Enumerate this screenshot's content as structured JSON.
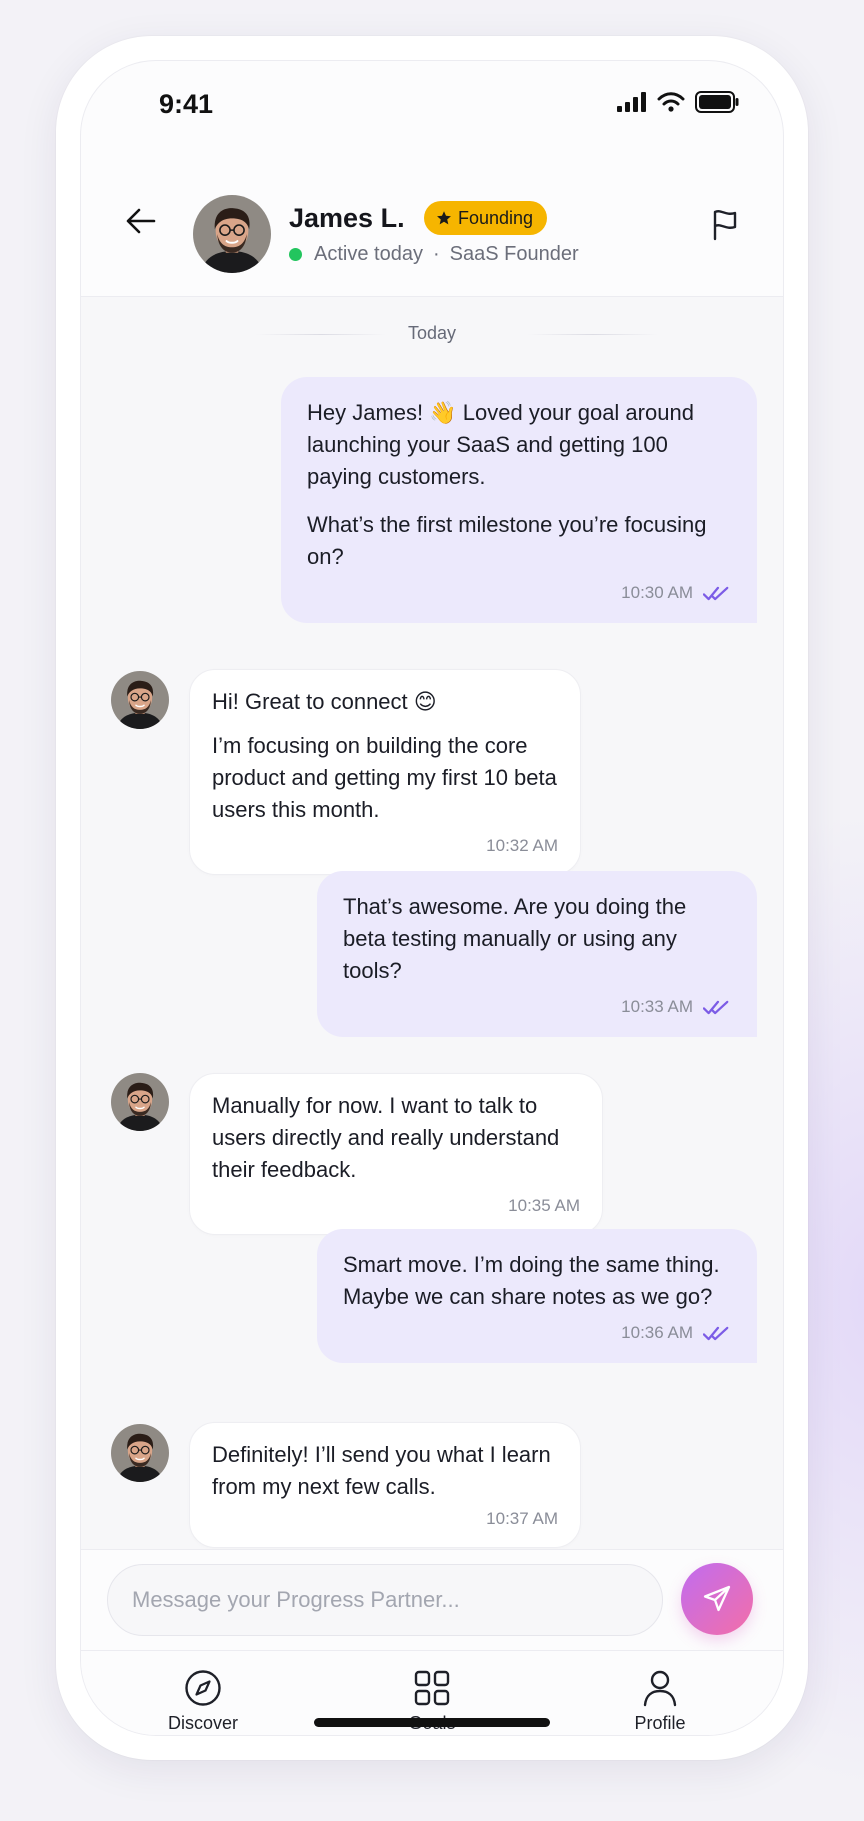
{
  "status_bar": {
    "time": "9:41"
  },
  "header": {
    "name": "James L.",
    "badge": "Founding",
    "presence": "Active today",
    "separator": "·",
    "role": "SaaS Founder"
  },
  "chat": {
    "day_label": "Today",
    "messages": [
      {
        "from": "me",
        "paragraphs": [
          "Hey James! 👋 Loved your goal around launching your SaaS and getting 100 paying customers.",
          "What’s the first milestone you’re focusing on?"
        ],
        "time": "10:30 AM",
        "status": "read"
      },
      {
        "from": "james",
        "paragraphs": [
          "Hi! Great to connect 😊",
          "I’m focusing on building the core product and getting my first 10 beta users this month."
        ],
        "time": "10:32 AM"
      },
      {
        "from": "me",
        "paragraphs": [
          "That’s awesome. Are you doing the beta testing manually or using any tools?"
        ],
        "time": "10:33 AM",
        "status": "read"
      },
      {
        "from": "james",
        "paragraphs": [
          "Manually for now. I want to talk to users directly and really understand their feedback."
        ],
        "time": "10:35 AM"
      },
      {
        "from": "me",
        "paragraphs": [
          "Smart move. I’m doing the same thing. Maybe we can share notes as we go?"
        ],
        "time": "10:36 AM",
        "status": "read"
      },
      {
        "from": "james",
        "paragraphs": [
          "Definitely! I’ll send you what I learn from my next few calls."
        ],
        "time": "10:37 AM"
      }
    ]
  },
  "composer": {
    "placeholder": "Message your Progress Partner..."
  },
  "tabs": [
    {
      "label": "Discover",
      "icon": "compass-icon"
    },
    {
      "label": "Goals",
      "icon": "grid-icon"
    },
    {
      "label": "Profile",
      "icon": "user-icon"
    }
  ],
  "colors": {
    "accent": "#7c5ce6",
    "outgoing_bubble": "#ece9fc",
    "badge": "#f6b500",
    "online": "#22c55e",
    "send_gradient_start": "#c06cf0",
    "send_gradient_end": "#f36fa8"
  }
}
